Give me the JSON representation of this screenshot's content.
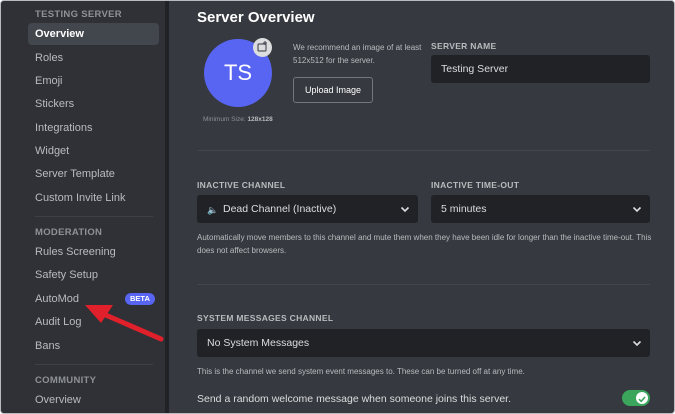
{
  "sidebar": {
    "sections": [
      {
        "heading": "TESTING SERVER",
        "items": [
          "Overview",
          "Roles",
          "Emoji",
          "Stickers",
          "Integrations",
          "Widget",
          "Server Template",
          "Custom Invite Link"
        ]
      },
      {
        "heading": "MODERATION",
        "items": [
          "Rules Screening",
          "Safety Setup",
          "AutoMod",
          "Audit Log",
          "Bans"
        ]
      },
      {
        "heading": "COMMUNITY",
        "items": [
          "Overview"
        ]
      }
    ],
    "active_item": "Overview",
    "beta_badge": "BETA"
  },
  "main": {
    "title": "Server Overview",
    "avatar_initials": "TS",
    "avatar_min_size_label": "Minimum Size:",
    "avatar_min_size_value": "128x128",
    "recommend_text": "We recommend an image of at least 512x512 for the server.",
    "upload_button": "Upload Image",
    "server_name_label": "SERVER NAME",
    "server_name_value": "Testing Server",
    "inactive_channel_label": "INACTIVE CHANNEL",
    "inactive_channel_value": "Dead Channel (Inactive)",
    "inactive_timeout_label": "INACTIVE TIME-OUT",
    "inactive_timeout_value": "5 minutes",
    "inactive_help": "Automatically move members to this channel and mute them when they have been idle for longer than the inactive time-out. This does not affect browsers.",
    "system_channel_label": "SYSTEM MESSAGES CHANNEL",
    "system_channel_value": "No System Messages",
    "system_help": "This is the channel we send system event messages to. These can be turned off at any time.",
    "welcome_toggle_label": "Send a random welcome message when someone joins this server.",
    "welcome_toggle_on": true
  },
  "colors": {
    "accent": "#5865f2",
    "toggle_on": "#3ba55c",
    "annotation_arrow": "#e0202a"
  }
}
